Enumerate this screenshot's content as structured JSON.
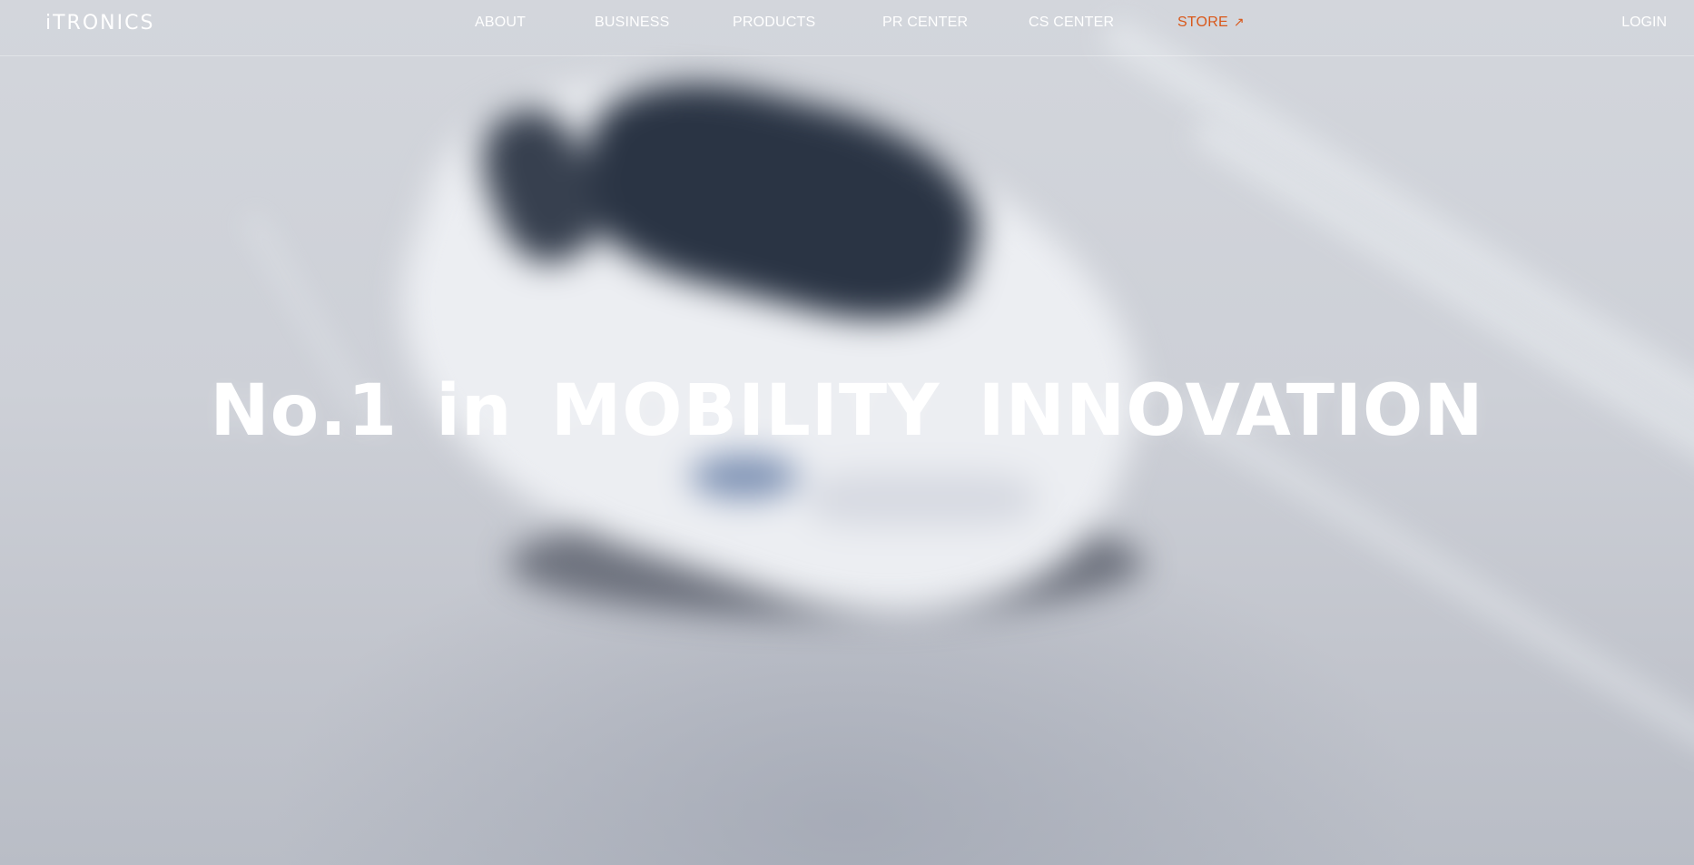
{
  "brand": {
    "logo_text": "iTRONICS"
  },
  "nav": {
    "items": [
      {
        "label": "ABOUT"
      },
      {
        "label": "BUSINESS"
      },
      {
        "label": "PRODUCTS"
      },
      {
        "label": "PR CENTER"
      },
      {
        "label": "CS CENTER"
      }
    ],
    "store": {
      "label": "STORE",
      "arrow": "↗"
    },
    "login_label": "LOGIN"
  },
  "hero": {
    "headline": "No.1 in MOBILITY INNOVATION"
  },
  "colors": {
    "store_accent": "#d9581a",
    "nav_text": "#ffffff",
    "background": "#c9ccd3"
  },
  "icons": {
    "store_arrow": "external-link-arrow-icon"
  }
}
